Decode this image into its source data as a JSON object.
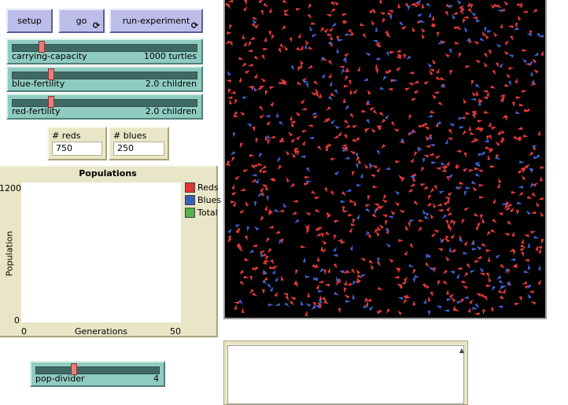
{
  "buttons": {
    "setup": "setup",
    "go": "go",
    "run_experiment": "run-experiment",
    "forever_symbol": "⟳"
  },
  "sliders": [
    {
      "label": "carrying-capacity",
      "value_text": "1000 turtles",
      "level": 0.15
    },
    {
      "label": "blue-fertility",
      "value_text": "2.0 children",
      "level": 0.2
    },
    {
      "label": "red-fertility",
      "value_text": "2.0 children",
      "level": 0.2
    }
  ],
  "monitors": [
    {
      "label": "# reds",
      "value": "750"
    },
    {
      "label": "# blues",
      "value": "250"
    }
  ],
  "plot": {
    "title": "Populations",
    "xlabel": "Generations",
    "ylabel": "Population",
    "x_min": "0",
    "x_max": "50",
    "y_min": "0",
    "y_max": "1200",
    "legend": [
      {
        "name": "Reds",
        "color": "#e03535"
      },
      {
        "name": "Blues",
        "color": "#3a5fb5"
      },
      {
        "name": "Total",
        "color": "#55b14a"
      }
    ]
  },
  "pop_divider": {
    "label": "pop-divider",
    "value_text": "4",
    "level": 0.3
  },
  "world": {
    "background": "#000000",
    "red_color": "#e03a3a",
    "blue_color": "#3d5fc9",
    "red_count": 750,
    "blue_count": 250
  }
}
